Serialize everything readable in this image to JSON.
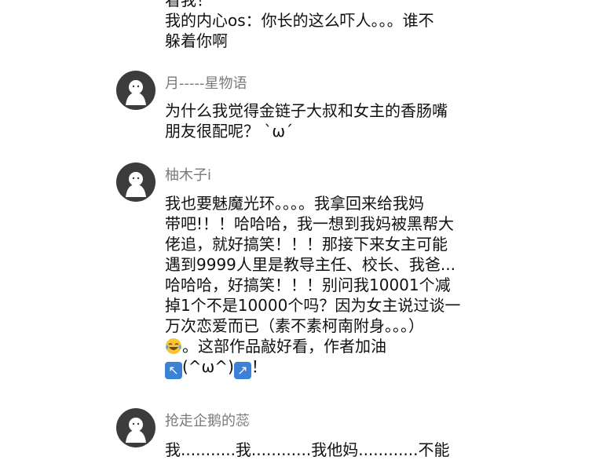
{
  "comments": [
    {
      "user": "",
      "lines": [
        "看我！",
        "我的内心os：你长的这么吓人。。。谁不",
        "躲着你啊"
      ]
    },
    {
      "user": "月-----星物语",
      "lines": [
        "为什么我觉得金链子大叔和女主的香肠嘴",
        "朋友很配呢？ `ω´"
      ]
    },
    {
      "user": "柚木子i",
      "lines": [
        "我也要魅魔光环。。。。我拿回来给我妈",
        "带吧!！！哈哈哈，我一想到我妈被黑帮大",
        "佬追，就好搞笑！！！那接下来女主可能",
        "遇到9999人里是教导主任、校长、我爸...",
        "哈哈哈，好搞笑！！！别问我10001个减",
        "掉1个不是10000个吗？因为女主说过谈一",
        "万次恋爱而已（素不素柯南附身。。。）"
      ],
      "line8_text": "。这部作品敲好看，作者加油",
      "line9_middle": "(^ω^)",
      "line9_end": "！",
      "emoji_joy": "face-with-tears-of-joy-emoji",
      "emoji_arrow_ul": "up-left-arrow-emoji",
      "emoji_arrow_ur": "up-right-arrow-emoji"
    },
    {
      "user": "抢走企鹅的蕊",
      "lines": [
        "我...........我............我他妈............不能"
      ]
    }
  ],
  "colors": {
    "avatar_bg": "#3c3c3c",
    "username": "#7a7a7a",
    "text": "#111111",
    "arrow_emoji": "#3b82d6"
  }
}
